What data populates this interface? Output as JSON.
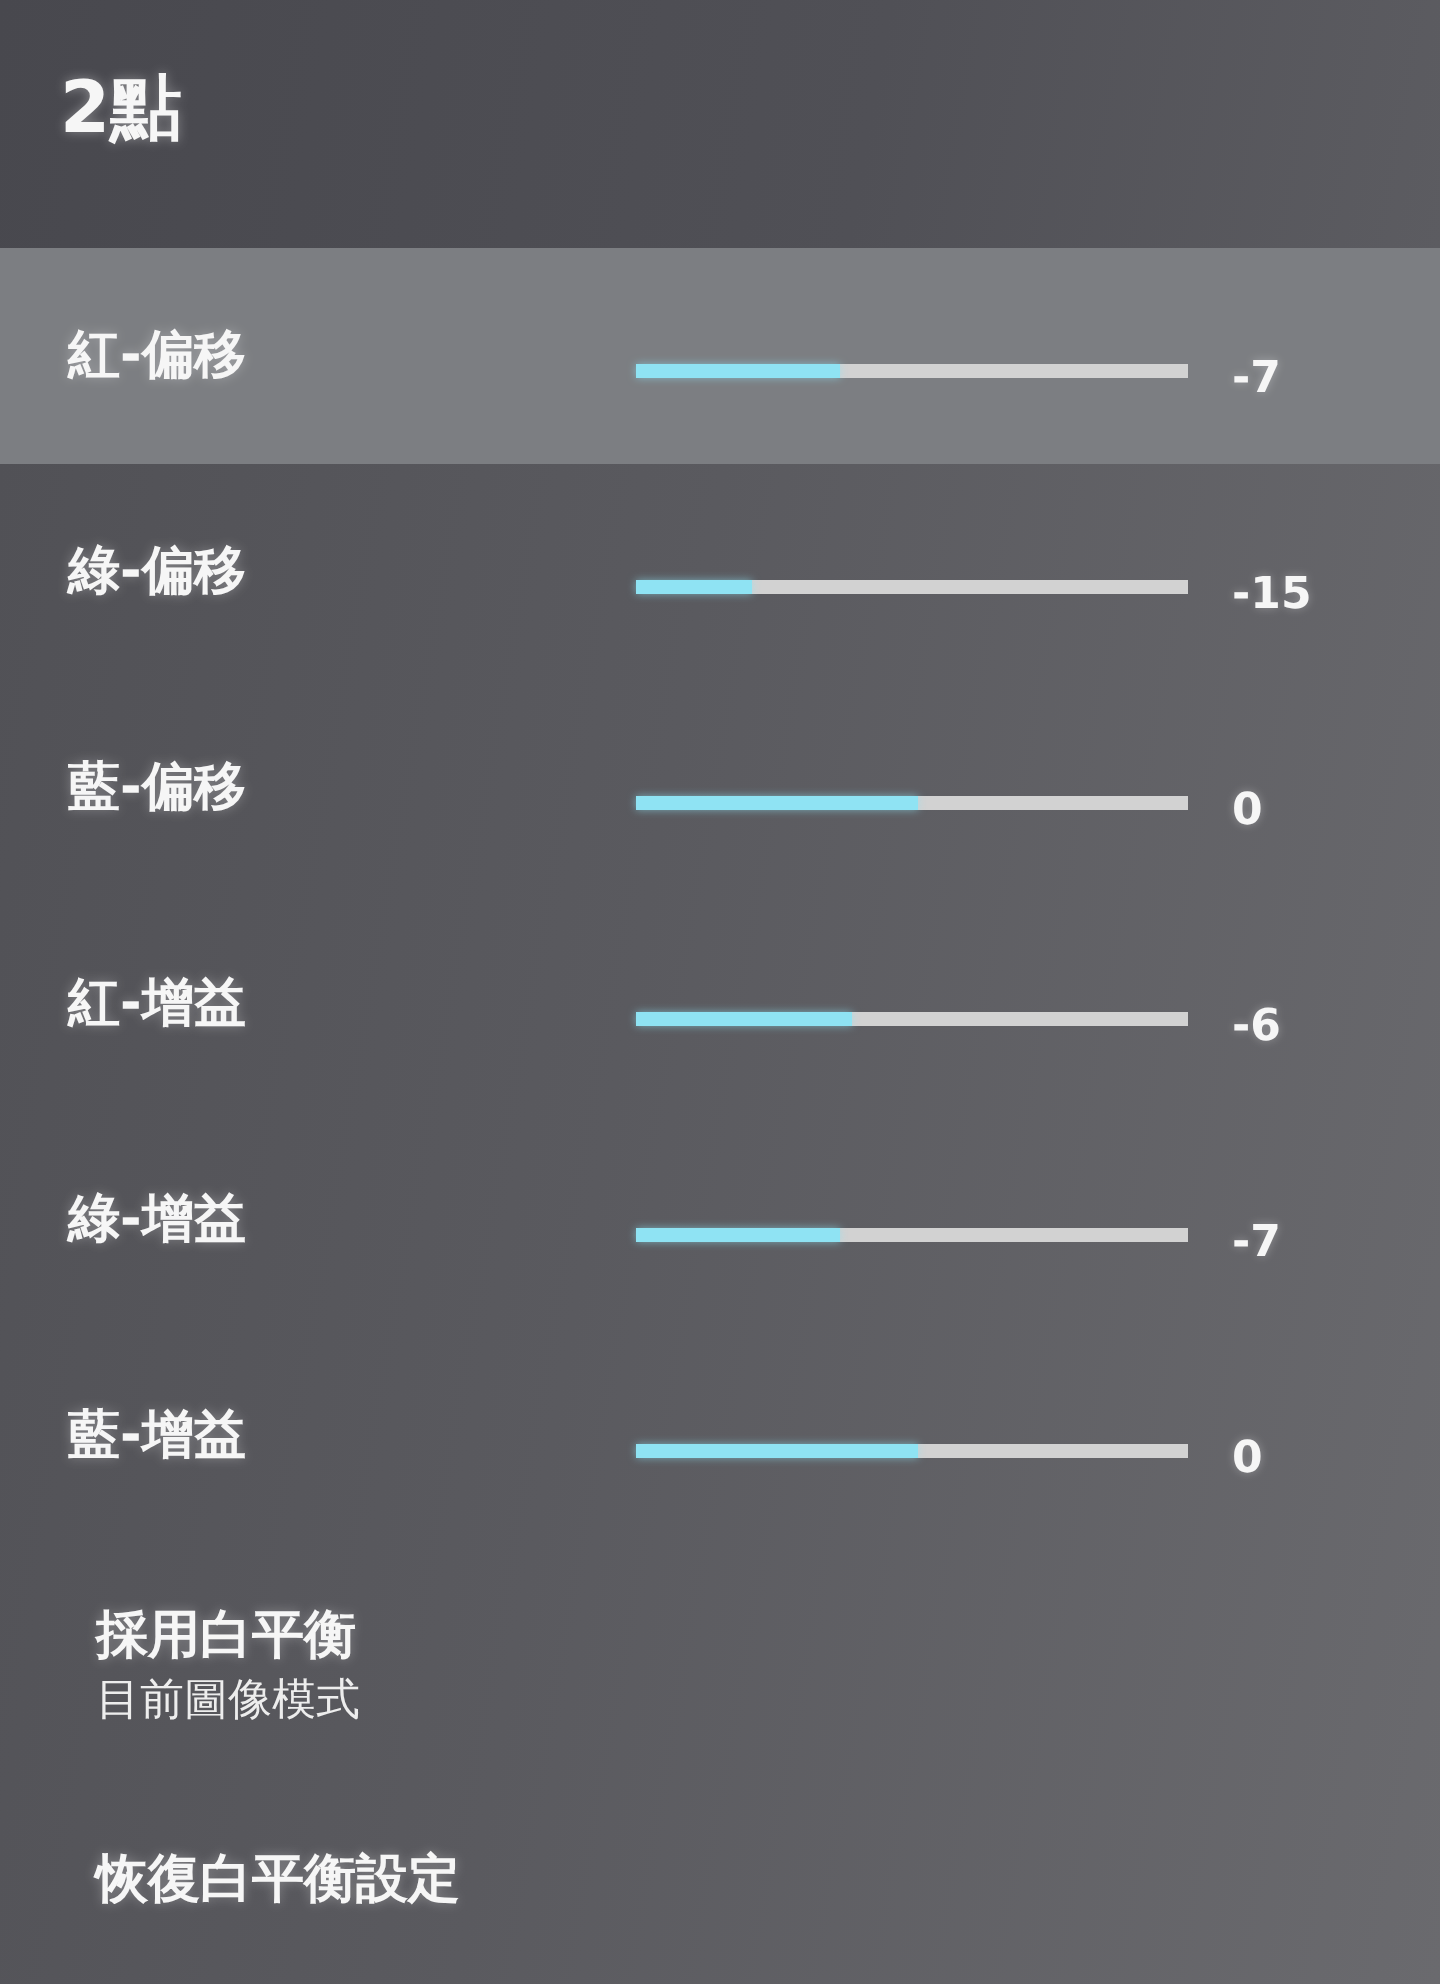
{
  "header": {
    "title": "2點"
  },
  "items": [
    {
      "kind": "slider",
      "label": "紅-偏移",
      "selected": true,
      "level": 0.37,
      "value": "-7"
    },
    {
      "kind": "slider",
      "label": "綠-偏移",
      "selected": false,
      "level": 0.21,
      "value": "-15"
    },
    {
      "kind": "slider",
      "label": "藍-偏移",
      "selected": false,
      "level": 0.51,
      "value": "0"
    },
    {
      "kind": "slider",
      "label": "紅-增益",
      "selected": false,
      "level": 0.39,
      "value": "-6"
    },
    {
      "kind": "slider",
      "label": "綠-增益",
      "selected": false,
      "level": 0.37,
      "value": "-7"
    },
    {
      "kind": "slider",
      "label": "藍-增益",
      "selected": false,
      "level": 0.51,
      "value": "0"
    },
    {
      "kind": "action",
      "label": "採用白平衡",
      "subtitle": "目前圖像模式",
      "selected": false
    },
    {
      "kind": "action",
      "label": "恢復白平衡設定",
      "selected": false
    }
  ]
}
